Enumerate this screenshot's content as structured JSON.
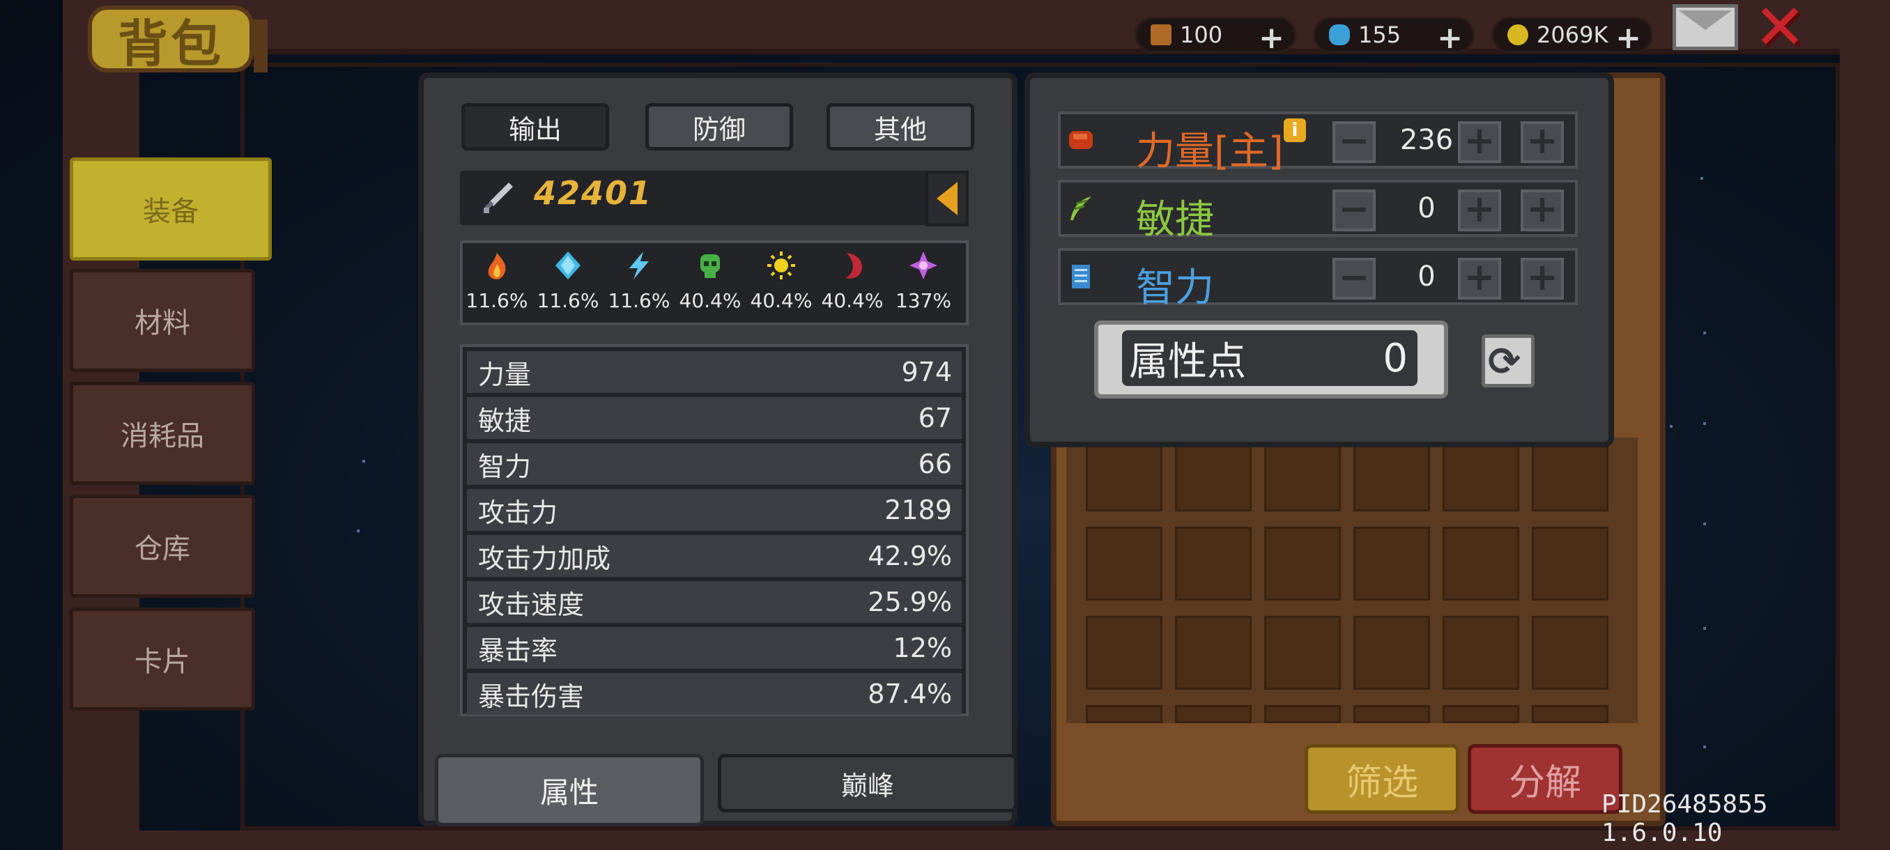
{
  "header": {
    "title": "背包",
    "currencies": [
      {
        "name": "guitar-currency",
        "value": "100",
        "color": "#b06a28"
      },
      {
        "name": "gem-currency",
        "value": "155",
        "color": "#3aa0d8"
      },
      {
        "name": "gold-currency",
        "value": "2069K",
        "color": "#d8b820"
      }
    ],
    "plus_label": "+"
  },
  "sidebar": {
    "items": [
      {
        "label": "装备",
        "active": true
      },
      {
        "label": "材料"
      },
      {
        "label": "消耗品"
      },
      {
        "label": "仓库"
      },
      {
        "label": "卡片"
      }
    ]
  },
  "stats_panel": {
    "tabs": [
      {
        "label": "输出"
      },
      {
        "label": "防御"
      },
      {
        "label": "其他"
      }
    ],
    "power": "42401",
    "elements": [
      {
        "icon": "fire-icon",
        "color": "#e86420",
        "pct": "11.6%"
      },
      {
        "icon": "ice-crystal-icon",
        "color": "#40b8e8",
        "pct": "11.6%"
      },
      {
        "icon": "lightning-icon",
        "color": "#60c8f0",
        "pct": "11.6%"
      },
      {
        "icon": "poison-skull-icon",
        "color": "#48b048",
        "pct": "40.4%"
      },
      {
        "icon": "light-sun-icon",
        "color": "#f0d020",
        "pct": "40.4%"
      },
      {
        "icon": "dark-moon-icon",
        "color": "#c02838",
        "pct": "40.4%"
      },
      {
        "icon": "arcane-star-icon",
        "color": "#c060e0",
        "pct": "137%"
      }
    ],
    "attributes": [
      {
        "label": "力量",
        "value": "974"
      },
      {
        "label": "敏捷",
        "value": "67"
      },
      {
        "label": "智力",
        "value": "66"
      },
      {
        "label": "攻击力",
        "value": "2189"
      },
      {
        "label": "攻击力加成",
        "value": "42.9%"
      },
      {
        "label": "攻击速度",
        "value": "25.9%"
      },
      {
        "label": "暴击率",
        "value": "12%"
      },
      {
        "label": "暴击伤害",
        "value": "87.4%"
      }
    ],
    "bottom_tabs": [
      {
        "label": "属性"
      },
      {
        "label": "巅峰"
      }
    ]
  },
  "alloc_panel": {
    "rows": [
      {
        "label": "力量[主]",
        "value": "236",
        "color": "#e06a28",
        "icon": "fist-icon"
      },
      {
        "label": "敏捷",
        "value": "0",
        "color": "#8cc840",
        "icon": "feather-icon"
      },
      {
        "label": "智力",
        "value": "0",
        "color": "#4aa0e0",
        "icon": "book-icon"
      }
    ],
    "points_label": "属性点",
    "points_value": "0",
    "minus": "−",
    "plus": "+",
    "info": "i"
  },
  "inventory": {
    "filter_label": "筛选",
    "decompose_label": "分解"
  },
  "footer": {
    "pid": "PID26485855 1.6.0.10"
  }
}
